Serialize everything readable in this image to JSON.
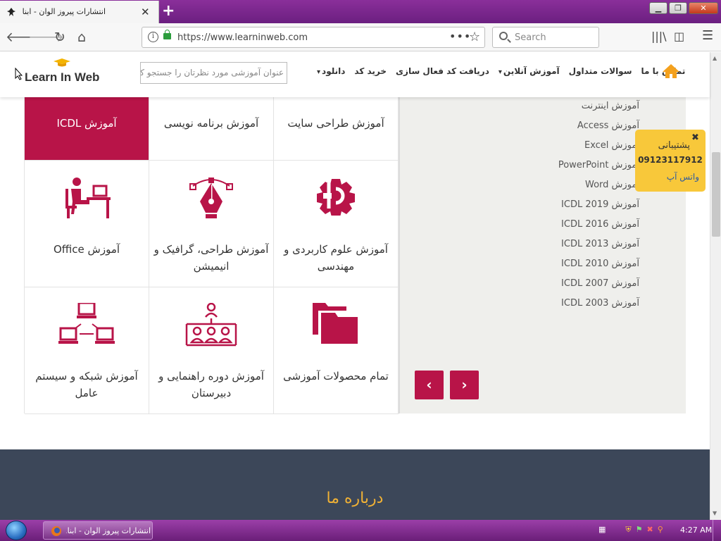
{
  "browser": {
    "tab_title": "انتشارات پیروز الوان - ابناک",
    "new_tab_label": "+",
    "url": "https://www.learninweb.com",
    "page_actions_label": "•••",
    "search_placeholder": "Search"
  },
  "site": {
    "logo_text": "Learn In Web",
    "search_placeholder": "عنوان آموزشی مورد نظرتان را جستجو کنید",
    "menu": [
      "دانلود",
      "خرید کد",
      "دریافت کد فعال سازی",
      "آموزش آنلاین",
      "سوالات متداول",
      "تماس با ما"
    ],
    "accent_color": "#b81448"
  },
  "categories": {
    "top": [
      "آموزش طراحی سایت",
      "آموزش برنامه نویسی",
      "آموزش ICDL"
    ],
    "active_index": 2,
    "row2": [
      {
        "label": "آموزش علوم کاربردی و مهندسی",
        "icon": "gear-engineering-icon"
      },
      {
        "label": "آموزش طراحی، گرافیک و انیمیشن",
        "icon": "pen-tool-icon"
      },
      {
        "label": "آموزش Office",
        "icon": "office-worker-icon"
      }
    ],
    "row3": [
      {
        "label": "تمام محصولات آموزشی",
        "icon": "folders-icon"
      },
      {
        "label": "آموزش دوره راهنمایی و دبیرستان",
        "icon": "students-group-icon"
      },
      {
        "label": "آموزش شبکه و سیستم عامل",
        "icon": "network-icon"
      }
    ]
  },
  "sidebar": {
    "items": [
      "آموزش اینترنت",
      "آموزش Access",
      "آموزش Excel",
      "آموزش PowerPoint",
      "آموزش Word",
      "آموزش ICDL 2019",
      "آموزش ICDL 2016",
      "آموزش ICDL 2013",
      "آموزش ICDL 2010",
      "آموزش ICDL 2007",
      "آموزش ICDL 2003"
    ],
    "prev_label": "‹",
    "next_label": "›"
  },
  "support": {
    "close_label": "✖",
    "title": "پشتیبانی",
    "phone": "09123117912",
    "whatsapp": "واتس آپ"
  },
  "about": {
    "heading": "درباره ما"
  },
  "taskbar": {
    "task_title": "انتشارات پیروز الوان - ابنا...",
    "clock": "4:27 AM"
  }
}
